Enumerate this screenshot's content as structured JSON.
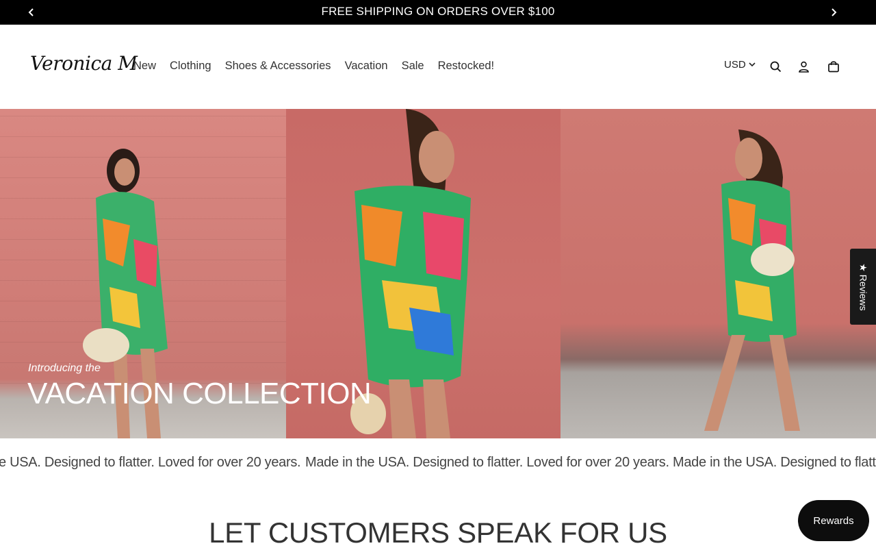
{
  "announcement": {
    "text": "FREE SHIPPING ON ORDERS OVER $100"
  },
  "header": {
    "logo_text": "Veronica M",
    "nav": [
      {
        "label": "New"
      },
      {
        "label": "Clothing"
      },
      {
        "label": "Shoes & Accessories"
      },
      {
        "label": "Vacation"
      },
      {
        "label": "Sale"
      },
      {
        "label": "Restocked!"
      }
    ],
    "currency": "USD"
  },
  "hero": {
    "subtitle": "Introducing the",
    "title": "VACATION COLLECTION"
  },
  "marquee": {
    "items": [
      "e USA. Designed to flatter. Loved for over 20 years.",
      "Made in the USA. Designed to flatter. Loved for over 20 years.",
      "Made in the USA. Designed to flatte"
    ]
  },
  "section": {
    "title": "LET CUSTOMERS SPEAK FOR US"
  },
  "widgets": {
    "reviews_label": "★ Reviews",
    "rewards_label": "Rewards"
  }
}
